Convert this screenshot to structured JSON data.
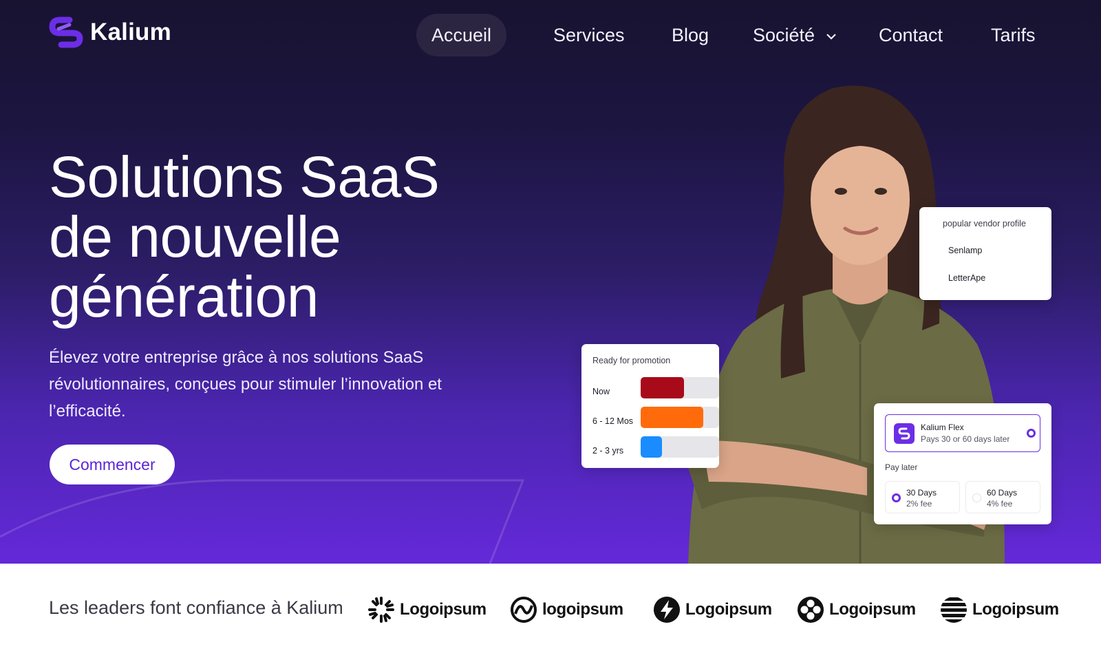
{
  "brand": {
    "name": "Kalium",
    "logo_icon": "kalium-swirl-icon",
    "accent_color": "#6b2ee6"
  },
  "nav": {
    "items": [
      {
        "label": "Accueil",
        "active": true
      },
      {
        "label": "Services"
      },
      {
        "label": "Blog"
      },
      {
        "label": "Société",
        "icon": "chevron-down-icon"
      },
      {
        "label": "Contact"
      },
      {
        "label": "Tarifs"
      }
    ]
  },
  "hero": {
    "title_lines": [
      "Solutions SaaS",
      "de nouvelle",
      "génération"
    ],
    "subtitle": "Élevez votre entreprise grâce à nos solutions SaaS révolutionnaires, conçues pour stimuler l’innovation et l’efficacité.",
    "cta_label": "Commencer",
    "gradient_colors": [
      "#181330",
      "#6429d9"
    ]
  },
  "vendor_card": {
    "title": "popular vendor profile",
    "items": [
      "Senlamp",
      "LetterApe"
    ]
  },
  "promo_card": {
    "title": "Ready for promotion",
    "rows": [
      {
        "label": "Now",
        "color": "#a80a1a",
        "fill": 0.55
      },
      {
        "label": "6 - 12 Mos",
        "color": "#ff6b0a",
        "fill": 0.8
      },
      {
        "label": "2 - 3 yrs",
        "color": "#1a8cff",
        "fill": 0.27
      }
    ]
  },
  "pay_card": {
    "plan_name": "Kalium Flex",
    "plan_desc": "Pays 30 or 60 days later",
    "section_label": "Pay later",
    "options": [
      {
        "days": "30 Days",
        "fee": "2% fee",
        "selected": true
      },
      {
        "days": "60 Days",
        "fee": "4% fee",
        "selected": false
      }
    ]
  },
  "trust": {
    "text": "Les leaders font confiance à Kalium",
    "logos": [
      {
        "name": "Logoipsum",
        "icon": "sunburst-icon"
      },
      {
        "name": "logoipsum",
        "icon": "wave-circle-icon"
      },
      {
        "name": "Logoipsum",
        "icon": "lightning-circle-icon"
      },
      {
        "name": "Logoipsum",
        "icon": "four-dots-circle-icon"
      },
      {
        "name": "Logoipsum",
        "icon": "striped-globe-icon"
      }
    ]
  }
}
